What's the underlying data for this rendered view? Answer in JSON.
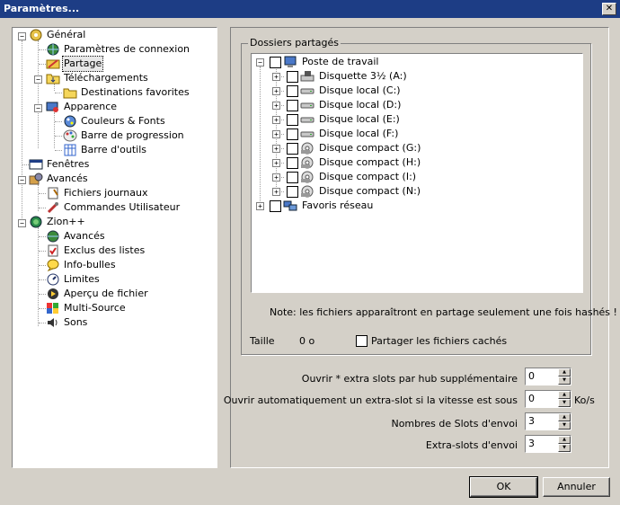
{
  "window": {
    "title": "Paramètres...",
    "close_glyph": "✕"
  },
  "tree": [
    {
      "label": "Général",
      "icon": "general-icon"
    },
    {
      "label": "Paramètres de connexion",
      "icon": "network-icon"
    },
    {
      "label": "Partage",
      "icon": "share-icon",
      "selected": true
    },
    {
      "label": "Téléchargements",
      "icon": "download-folder-icon"
    },
    {
      "label": "Destinations favorites",
      "icon": "folder-icon"
    },
    {
      "label": "Apparence",
      "icon": "appearance-icon"
    },
    {
      "label": "Couleurs & Fonts",
      "icon": "colors-icon"
    },
    {
      "label": "Barre de progression",
      "icon": "palette-icon"
    },
    {
      "label": "Barre d'outils",
      "icon": "toolbar-icon"
    },
    {
      "label": "Fenêtres",
      "icon": "window-icon"
    },
    {
      "label": "Avancés",
      "icon": "advanced-icon"
    },
    {
      "label": "Fichiers journaux",
      "icon": "log-icon"
    },
    {
      "label": "Commandes Utilisateur",
      "icon": "commands-icon"
    },
    {
      "label": "Zion++",
      "icon": "zion-icon"
    },
    {
      "label": "Avancés",
      "icon": "advanced-globe-icon"
    },
    {
      "label": "Exclus des listes",
      "icon": "exclude-icon"
    },
    {
      "label": "Info-bulles",
      "icon": "tooltip-icon"
    },
    {
      "label": "Limites",
      "icon": "limits-icon"
    },
    {
      "label": "Aperçu de fichier",
      "icon": "preview-icon"
    },
    {
      "label": "Multi-Source",
      "icon": "multisource-icon"
    },
    {
      "label": "Sons",
      "icon": "sounds-icon"
    }
  ],
  "shares": {
    "group_label": "Dossiers partagés",
    "root": "Poste de travail",
    "drives": [
      "Disquette 3½ (A:)",
      "Disque local (C:)",
      "Disque local (D:)",
      "Disque local (E:)",
      "Disque local (F:)",
      "Disque compact (G:)",
      "Disque compact (H:)",
      "Disque compact (I:)",
      "Disque compact (N:)"
    ],
    "network": "Favoris réseau",
    "note": "Note: les fichiers apparaîtront en partage seulement une fois hashés !",
    "size_label": "Taille",
    "size_value": "0 o",
    "hidden_label": "Partager les fichiers cachés"
  },
  "settings": {
    "extra_slots_label": "Ouvrir * extra slots par hub supplémentaire",
    "extra_slots_value": "0",
    "auto_slot_label": "Ouvrir automatiquement un extra-slot si la vitesse est sous",
    "auto_slot_value": "0",
    "auto_slot_unit": "Ko/s",
    "upload_slots_label": "Nombres de Slots d'envoi",
    "upload_slots_value": "3",
    "extra_upload_label": "Extra-slots d'envoi",
    "extra_upload_value": "3"
  },
  "buttons": {
    "ok": "OK",
    "cancel": "Annuler"
  },
  "colors": {
    "titlebar": "#1d3d85",
    "face": "#d4d0c8"
  }
}
